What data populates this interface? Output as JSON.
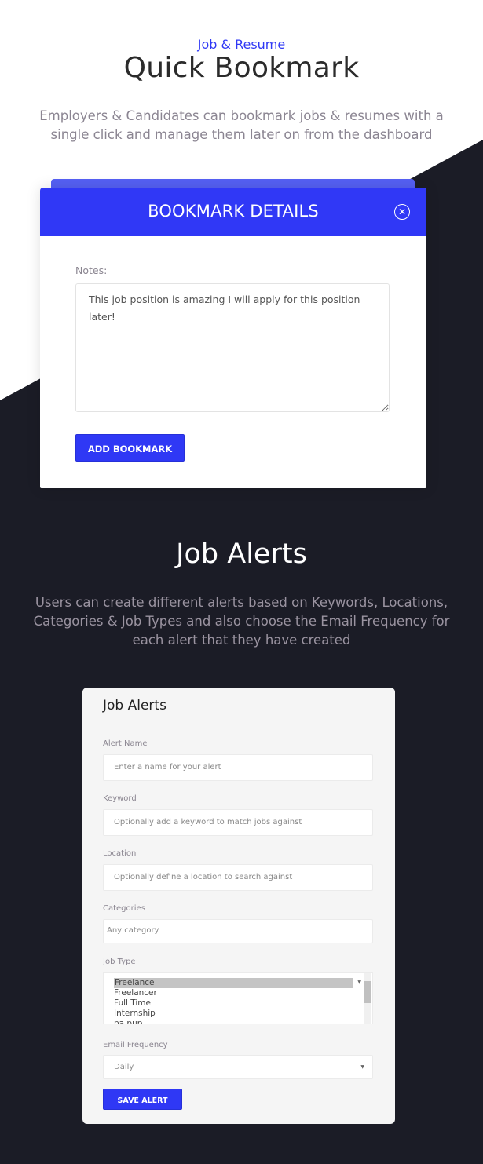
{
  "colors": {
    "accent": "#2f38f5",
    "dark_bg": "#1b1c26",
    "light_bg": "#ffffff"
  },
  "bookmark_section": {
    "eyebrow": "Job & Resume",
    "title": "Quick Bookmark",
    "description": "Employers & Candidates can bookmark jobs & resumes with a single click and manage them later on from the dashboard",
    "modal": {
      "title": "BOOKMARK DETAILS",
      "close_icon": "close-circle-icon",
      "notes_label": "Notes:",
      "notes_value": "This job position is amazing I will apply for this position later!",
      "add_button": "ADD BOOKMARK"
    }
  },
  "alerts_section": {
    "title": "Job Alerts",
    "description": "Users can create different alerts based on Keywords, Locations, Categories & Job Types and also choose the Email Frequency for each alert that they have created",
    "form": {
      "title": "Job Alerts",
      "alert_name": {
        "label": "Alert Name",
        "placeholder": "Enter a name for your alert"
      },
      "keyword": {
        "label": "Keyword",
        "placeholder": "Optionally add a keyword to match jobs against"
      },
      "location": {
        "label": "Location",
        "placeholder": "Optionally define a location to search against"
      },
      "categories": {
        "label": "Categories",
        "placeholder": "Any category"
      },
      "job_type": {
        "label": "Job Type",
        "options": [
          "Freelance",
          "Freelancer",
          "Full Time",
          "Internship",
          "pa pup"
        ],
        "selected": "Freelance"
      },
      "email_frequency": {
        "label": "Email Frequency",
        "value": "Daily"
      },
      "save_button": "SAVE ALERT"
    }
  }
}
